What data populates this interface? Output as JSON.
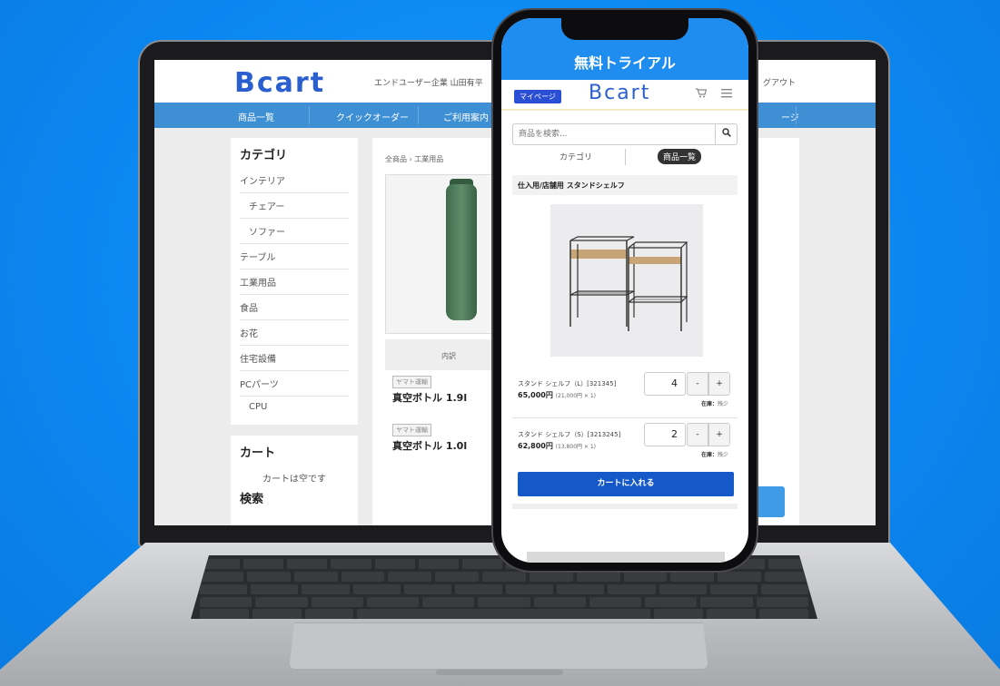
{
  "desktop": {
    "logo": "Bcart",
    "header_text": "エンドユーザー企業  山田有平",
    "header_right": "グアウト",
    "nav": [
      "商品一覧",
      "クイックオーダー",
      "ご利用案内",
      "ージ"
    ],
    "sidebar": {
      "category_title": "カテゴリ",
      "categories": [
        {
          "label": "インテリア",
          "sub": false
        },
        {
          "label": "チェアー",
          "sub": true
        },
        {
          "label": "ソファー",
          "sub": true
        },
        {
          "label": "テーブル",
          "sub": false
        },
        {
          "label": "工業用品",
          "sub": false
        },
        {
          "label": "食品",
          "sub": false
        },
        {
          "label": "お花",
          "sub": false
        },
        {
          "label": "住宅設備",
          "sub": false
        },
        {
          "label": "PCパーツ",
          "sub": false
        },
        {
          "label": "CPU",
          "sub": true
        }
      ],
      "cart_title": "カート",
      "cart_empty": "カートは空です",
      "search_title": "検索"
    },
    "breadcrumb": "全商品 › 工業用品",
    "table_head": "内訳",
    "products": [
      {
        "tag": "ヤマト運輸",
        "name": "真空ボトル 1.9l"
      },
      {
        "tag": "ヤマト運輸",
        "name": "真空ボトル 1.0l"
      }
    ]
  },
  "phone": {
    "trial_banner": "無料トライアル",
    "mypage_label": "マイページ",
    "logo": "Bcart",
    "search_placeholder": "商品を検索...",
    "tab_category": "カテゴリ",
    "tab_products": "商品一覧",
    "product_title": "仕入用/店舗用  スタンドシェルフ",
    "rows": [
      {
        "name": "スタンド  シェルフ（L）[321345]",
        "price": "65,000円",
        "price_detail": "(21,000円 × 1)",
        "qty": "4",
        "stock_label": "在庫：",
        "stock_value": "残少"
      },
      {
        "name": "スタンド  シェルフ（S）[3213245]",
        "price": "62,800円",
        "price_detail": "(13,800円 × 1)",
        "qty": "2",
        "stock_label": "在庫：",
        "stock_value": "残少"
      }
    ],
    "minus": "-",
    "plus": "+",
    "cart_button": "カートに入れる"
  },
  "icons": {
    "search": "search-icon",
    "cart": "cart-icon",
    "menu": "menu-icon"
  },
  "colors": {
    "background": "#0b86f0",
    "brand_blue": "#1f8df0",
    "cart_button": "#1559c8",
    "nav_blue": "#3f8fd4"
  }
}
